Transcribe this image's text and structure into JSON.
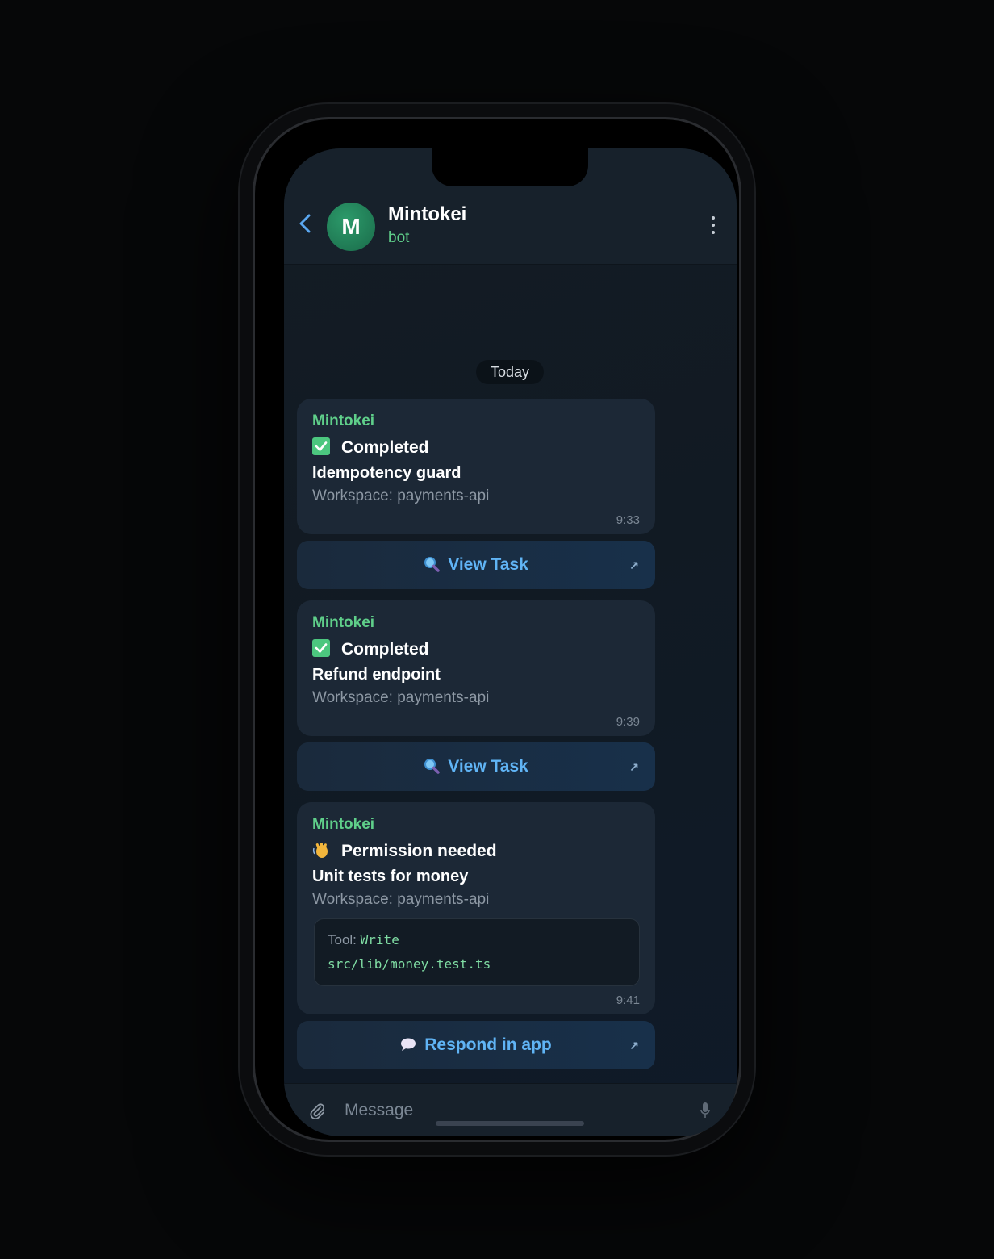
{
  "header": {
    "contact_name": "Mintokei",
    "contact_status": "bot",
    "avatar_letter": "M"
  },
  "date_separator": "Today",
  "messages": [
    {
      "sender": "Mintokei",
      "status_icon": "check-box-icon",
      "status": "Completed",
      "task": "Idempotency guard",
      "workspace": "Workspace: payments-api",
      "time": "9:33",
      "button": {
        "icon": "magnifier-icon",
        "label": "View Task",
        "arrow": "↗"
      }
    },
    {
      "sender": "Mintokei",
      "status_icon": "check-box-icon",
      "status": "Completed",
      "task": "Refund endpoint",
      "workspace": "Workspace: payments-api",
      "time": "9:39",
      "button": {
        "icon": "magnifier-icon",
        "label": "View Task",
        "arrow": "↗"
      }
    },
    {
      "sender": "Mintokei",
      "status_icon": "waving-hand-icon",
      "status": "Permission needed",
      "task": "Unit tests for money",
      "workspace": "Workspace: payments-api",
      "tool_label": "Tool:",
      "tool_name": "Write",
      "tool_path": "src/lib/money.test.ts",
      "time": "9:41",
      "button": {
        "icon": "speech-bubble-icon",
        "label": "Respond in app",
        "arrow": "↗"
      }
    }
  ],
  "composer": {
    "placeholder": "Message"
  },
  "colors": {
    "accent_green": "#5fcf8a",
    "link_blue": "#60b4f5",
    "bubble_bg": "#1c2836"
  }
}
